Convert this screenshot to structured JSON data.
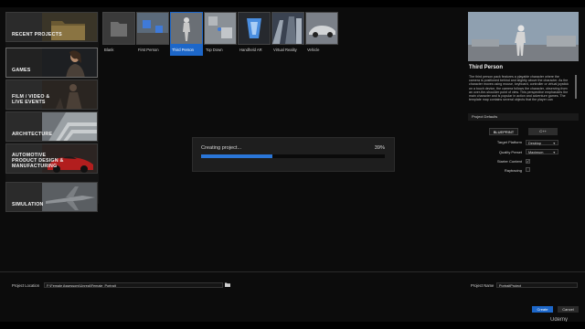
{
  "categories": [
    {
      "label": "RECENT PROJECTS",
      "selected": false,
      "icon": "folder-art"
    },
    {
      "label": "GAMES",
      "selected": true,
      "icon": "character-art"
    },
    {
      "label": "FILM / VIDEO &\nLIVE EVENTS",
      "selected": false,
      "icon": "figure-art"
    },
    {
      "label": "ARCHITECTURE",
      "selected": false,
      "icon": "building-art"
    },
    {
      "label": "AUTOMOTIVE\nPRODUCT DESIGN &\nMANUFACTURING",
      "selected": false,
      "icon": "car-art"
    },
    {
      "label": "SIMULATION",
      "selected": false,
      "icon": "jet-art"
    }
  ],
  "templates": [
    {
      "label": "Blank",
      "selected": false
    },
    {
      "label": "First Person",
      "selected": false
    },
    {
      "label": "Third Person",
      "selected": true
    },
    {
      "label": "Top Down",
      "selected": false
    },
    {
      "label": "Handheld AR",
      "selected": false
    },
    {
      "label": "Virtual Reality",
      "selected": false
    },
    {
      "label": "Vehicle",
      "selected": false
    }
  ],
  "progress": {
    "title": "Creating project...",
    "percent_text": "39%",
    "fraction": 0.39
  },
  "details": {
    "title": "Third Person",
    "description": "The third person pack features a playable character where the camera is positioned behind and slightly above the character. As the character moves using mouse, keyboard, controller or virtual joystick on a touch device, the camera follows the character, observing from an over-the-shoulder point of view. This perspective emphasizes the main character and is popular in action and adventure games. The template map contains several objects that the player can",
    "defaults_header": "Project Defaults",
    "blueprint_label": "BLUEPRINT",
    "cpp_label": "C++",
    "target_platform_label": "Target Platform",
    "target_platform_value": "Desktop",
    "quality_label": "Quality Preset",
    "quality_value": "Maximum",
    "starter_label": "Starter Content",
    "starter_checked": true,
    "raytracing_label": "Raytracing",
    "raytracing_checked": false
  },
  "bottom": {
    "location_label": "Project Location",
    "location_value": "F:\\Female Assessors\\Unreal\\Female_Portrait",
    "name_label": "Project Name",
    "name_value": "PortraitProject",
    "create_label": "Create",
    "cancel_label": "Cancel"
  },
  "watermark": "Udemy",
  "colors": {
    "accent": "#1d67c9",
    "background": "#0c0c0c",
    "panel": "#1e1e1e"
  }
}
